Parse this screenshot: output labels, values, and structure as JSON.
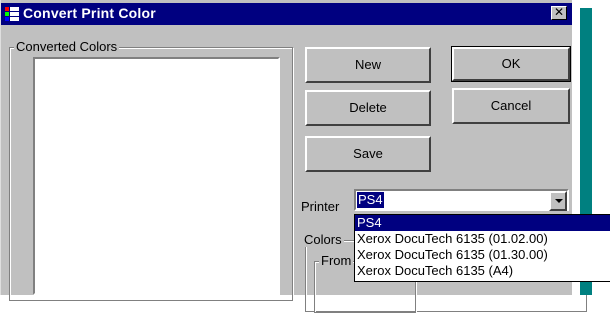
{
  "window": {
    "title": "Convert Print Color",
    "close_glyph": "✕",
    "icon": "app-icon"
  },
  "converted_colors": {
    "label": "Converted Colors",
    "items": []
  },
  "buttons": {
    "new": "New",
    "ok": "OK",
    "delete": "Delete",
    "cancel": "Cancel",
    "save": "Save"
  },
  "printer": {
    "label": "Printer",
    "selected": "PS4",
    "options": [
      "PS4",
      "Xerox DocuTech 6135 (01.02.00)",
      "Xerox DocuTech 6135 (01.30.00)",
      "Xerox DocuTech 6135 (A4)"
    ],
    "highlighted_option": "PS4"
  },
  "colors_group": {
    "label": "Colors",
    "from_label": "From"
  },
  "colors": {
    "title_bar": "#000080",
    "dialog_face": "#c0c0c0",
    "selection": "#000080",
    "background_accent": "#008080"
  }
}
